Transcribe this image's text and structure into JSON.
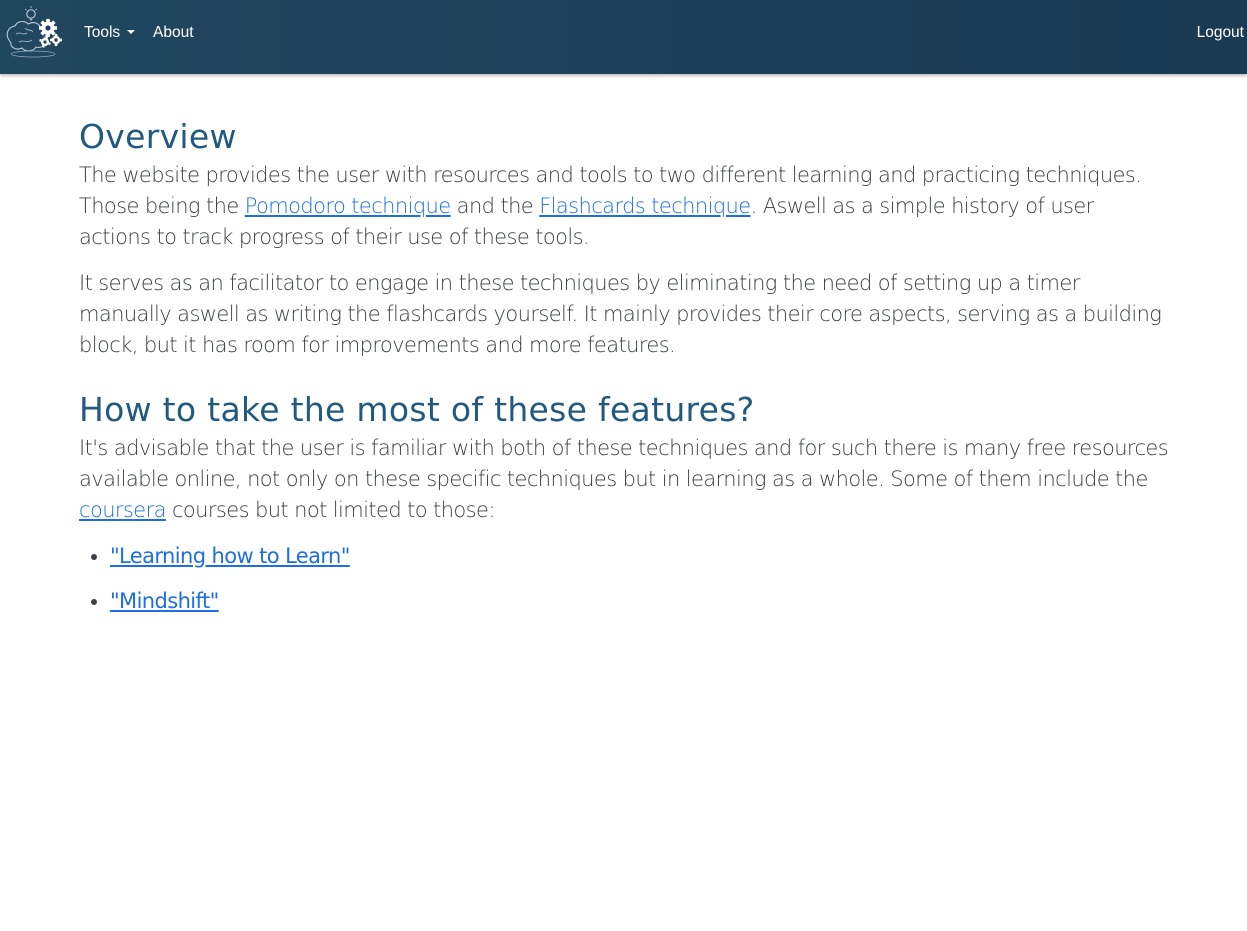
{
  "navbar": {
    "tools_label": "Tools",
    "about_label": "About",
    "logout_label": "Logout",
    "colors": {
      "background": "#1d3f59",
      "text": "#ffffff"
    }
  },
  "overview": {
    "heading": "Overview",
    "p1_part1": "The website provides the user with resources and tools to two different learning and practicing techniques. Those being the ",
    "p1_link1": "Pomodoro technique",
    "p1_part2": " and the ",
    "p1_link2": "Flashcards technique",
    "p1_part3": ". Aswell as a simple history of user actions to track progress of their use of these tools.",
    "p2": "It serves as an facilitator to engage in these techniques by eliminating the need of setting up a timer manually aswell as writing the flashcards yourself. It mainly provides their core aspects, serving as a building block, but it has room for improvements and more features."
  },
  "howto": {
    "heading": "How to take the most of these features?",
    "p1_part1": "It's advisable that the user is familiar with both of these techniques and for such there is many free resources available online, not only on these specific techniques but in learning as a whole. Some of them include the ",
    "p1_link": "coursera",
    "p1_part2": " courses but not limited to those:",
    "courses": [
      "\"Learning how to Learn\"",
      "\"Mindshift\""
    ]
  },
  "colors": {
    "heading": "#22597f",
    "text": "#3b4045",
    "link": "#1d6fe0"
  },
  "icons": {
    "logo": "brain-gears-lightbulb-logo",
    "dropdown": "caret-down-icon"
  }
}
